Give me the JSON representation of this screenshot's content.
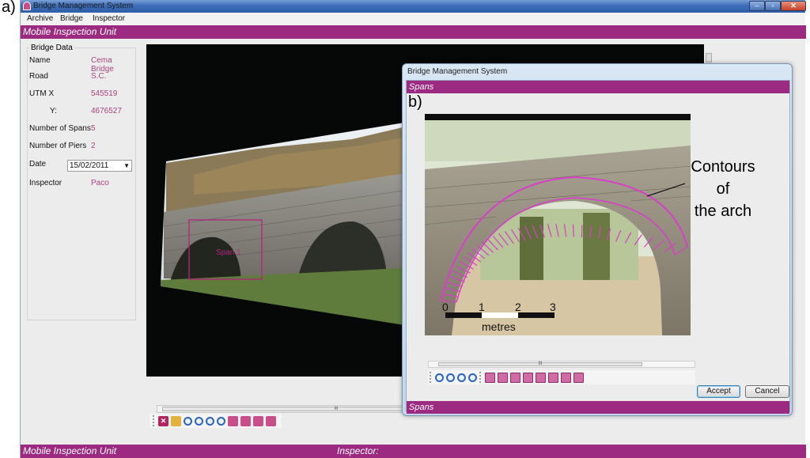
{
  "figure_labels": {
    "a": "a)",
    "b": "b)"
  },
  "window": {
    "title": "Bridge Management System"
  },
  "menu": {
    "items": [
      "Archive",
      "Bridge",
      "Inspector"
    ]
  },
  "header": {
    "title": "Mobile Inspection Unit"
  },
  "footer": {
    "left": "Mobile Inspection Unit",
    "inspector_label": "Inspector:"
  },
  "bridge_data": {
    "legend": "Bridge Data",
    "name_label": "Name",
    "name_value": "Cema Bridge",
    "road_label": "Road",
    "road_value": "S.C.",
    "utmx_label": "UTM X",
    "utmx_value": "545519",
    "y_label": "Y:",
    "y_value": "4676527",
    "spans_label": "Number of Spans",
    "spans_value": "5",
    "piers_label": "Number of Piers",
    "piers_value": "2",
    "date_label": "Date",
    "date_value": "15/02/2011",
    "inspector_label": "Inspector",
    "inspector_value": "Paco"
  },
  "main_canvas": {
    "span_label": "Span 1"
  },
  "dialog": {
    "title": "Bridge Management System",
    "header": "Spans",
    "footer": "Spans",
    "accept": "Accept",
    "cancel": "Cancel",
    "scale": {
      "ticks": [
        "0",
        "1",
        "2",
        "3"
      ],
      "unit": "metres"
    }
  },
  "callout": {
    "line1": "Contours",
    "line2": "of",
    "line3": "the arch"
  },
  "colors": {
    "accent": "#9b2a80",
    "value_text": "#a8447f",
    "contour": "#d83fc8"
  },
  "icons": {
    "main_toolbar": [
      "delete-icon",
      "open-folder-icon",
      "zoom-in-icon",
      "zoom-out-icon",
      "zoom-in-icon",
      "zoom-out-icon",
      "zoom-fit-icon",
      "crop-icon",
      "arch-icon",
      "span-icon"
    ],
    "dialog_toolbar": [
      "zoom-in-icon",
      "zoom-out-icon",
      "zoom-in-icon",
      "zoom-out-icon",
      "grid-tool-icon",
      "grid-tool-icon",
      "grid-tool-icon",
      "grid-tool-icon",
      "grid-tool-icon",
      "grid-tool-icon",
      "grid-tool-icon",
      "grid-tool-icon"
    ]
  }
}
